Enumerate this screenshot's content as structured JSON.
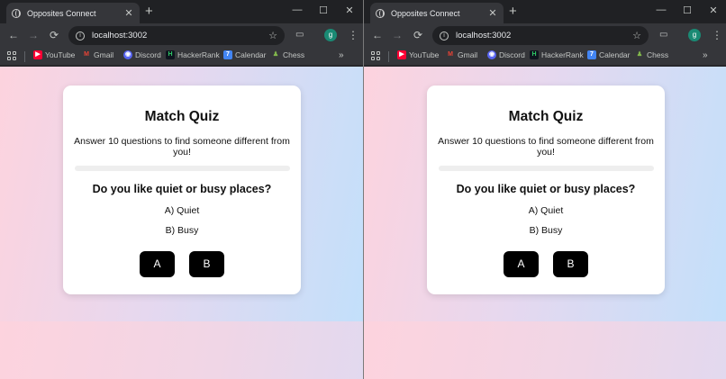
{
  "windows": [
    {
      "tab": {
        "title": "Opposites Connect",
        "close": "✕"
      },
      "newtab": "+",
      "controls": {
        "minimize": "—",
        "maximize": "☐",
        "close": "✕"
      },
      "nav": {
        "back": "←",
        "forward": "→",
        "reload": "⟳"
      },
      "url": "localhost:3002",
      "avatar_letter": "g",
      "bookmarks": [
        {
          "label": "YouTube",
          "icon": "youtube-icon",
          "color": "#ff0033"
        },
        {
          "label": "Gmail",
          "icon": "gmail-icon",
          "color": "#ea4335"
        },
        {
          "label": "Discord",
          "icon": "discord-icon",
          "color": "#5865f2"
        },
        {
          "label": "HackerRank",
          "icon": "hackerrank-icon",
          "color": "#0e141e"
        },
        {
          "label": "Calendar",
          "icon": "calendar-icon",
          "color": "#4285f4"
        },
        {
          "label": "Chess",
          "icon": "chess-icon",
          "color": "#81b64c"
        }
      ],
      "bookmarks_more": "»",
      "quiz": {
        "title": "Match Quiz",
        "description": "Answer 10 questions to find someone different from you!",
        "progress": 0.0,
        "question": "Do you like quiet or busy places?",
        "option_a": "A) Quiet",
        "option_b": "B) Busy",
        "button_a": "A",
        "button_b": "B"
      }
    },
    {
      "tab": {
        "title": "Opposites Connect",
        "close": "✕"
      },
      "newtab": "+",
      "controls": {
        "minimize": "—",
        "maximize": "☐",
        "close": "✕"
      },
      "nav": {
        "back": "←",
        "forward": "→",
        "reload": "⟳"
      },
      "url": "localhost:3002",
      "avatar_letter": "g",
      "bookmarks": [
        {
          "label": "YouTube",
          "icon": "youtube-icon",
          "color": "#ff0033"
        },
        {
          "label": "Gmail",
          "icon": "gmail-icon",
          "color": "#ea4335"
        },
        {
          "label": "Discord",
          "icon": "discord-icon",
          "color": "#5865f2"
        },
        {
          "label": "HackerRank",
          "icon": "hackerrank-icon",
          "color": "#0e141e"
        },
        {
          "label": "Calendar",
          "icon": "calendar-icon",
          "color": "#4285f4"
        },
        {
          "label": "Chess",
          "icon": "chess-icon",
          "color": "#81b64c"
        }
      ],
      "bookmarks_more": "»",
      "quiz": {
        "title": "Match Quiz",
        "description": "Answer 10 questions to find someone different from you!",
        "progress": 0.0,
        "question": "Do you like quiet or busy places?",
        "option_a": "A) Quiet",
        "option_b": "B) Busy",
        "button_a": "A",
        "button_b": "B"
      }
    }
  ]
}
